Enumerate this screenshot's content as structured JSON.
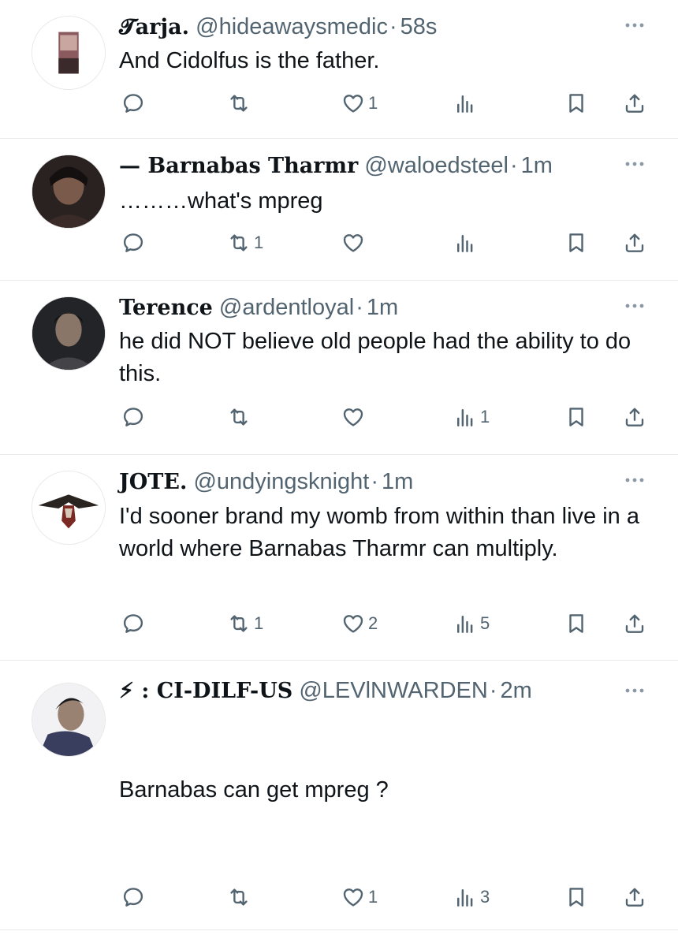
{
  "tweets": [
    {
      "display_name": "𝓣arja.",
      "handle": "@hideawaysmedic",
      "time": "58s",
      "text": "And Cidolfus is the father.",
      "replies": "",
      "retweets": "",
      "likes": "1",
      "views": ""
    },
    {
      "display_name": "— Barnabas Tharmr",
      "handle": "@waloedsteel",
      "time": "1m",
      "text": "………what's mpreg",
      "replies": "",
      "retweets": "1",
      "likes": "",
      "views": ""
    },
    {
      "display_name": "Terence",
      "handle": "@ardentloyal",
      "time": "1m",
      "text": "he did NOT believe old people had the ability to do this.",
      "replies": "",
      "retweets": "",
      "likes": "",
      "views": "1"
    },
    {
      "display_name": "JOTE.",
      "handle": "@undyingsknight",
      "time": "1m",
      "text": "I'd sooner brand my womb from within than live in a world where Barnabas Tharmr can multiply.",
      "replies": "",
      "retweets": "1",
      "likes": "2",
      "views": "5"
    },
    {
      "display_name": "⚡︎ : CI-DILF-US",
      "handle": "@LEVlNWARDEN",
      "time": "2m",
      "text": "Barnabas can get mpreg ?",
      "replies": "",
      "retweets": "",
      "likes": "1",
      "views": "3"
    }
  ],
  "icons": {
    "reply": "reply-icon",
    "retweet": "retweet-icon",
    "like": "heart-icon",
    "views": "views-icon",
    "bookmark": "bookmark-icon",
    "share": "share-icon",
    "more": "more-icon"
  },
  "colors": {
    "text": "#0f1419",
    "secondary": "#536471",
    "divider": "#e7e9ea"
  }
}
